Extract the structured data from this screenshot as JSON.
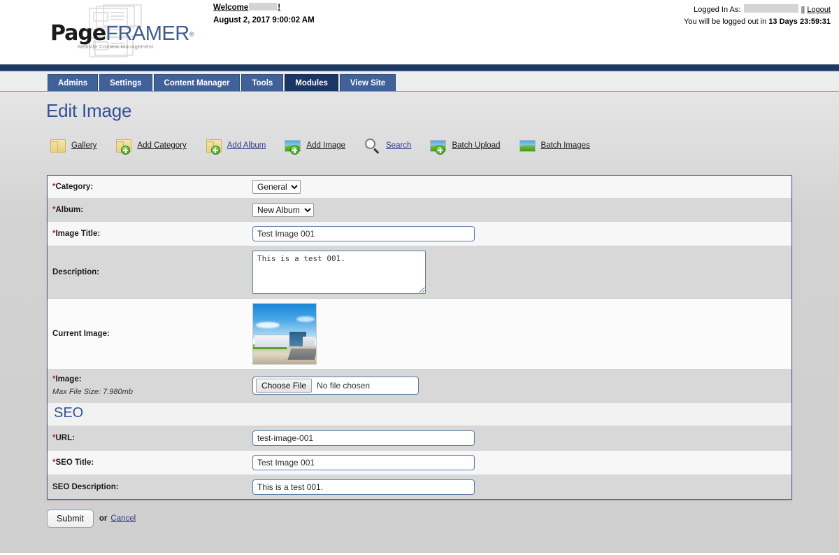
{
  "header": {
    "logo": {
      "part1": "Page",
      "part2": "FRAMER",
      "registered": "®",
      "tagline": "Website Content Management"
    },
    "welcome_label": "Welcome",
    "welcome_suffix": "!",
    "datetime": "August 2, 2017 9:00:02 AM",
    "logged_in_label": "Logged In As:",
    "separator": "||",
    "logout_label": "Logout",
    "logout_notice_prefix": "You will be logged out in",
    "logout_countdown": "13 Days 23:59:31"
  },
  "nav": {
    "tabs": [
      {
        "label": "Admins",
        "active": false
      },
      {
        "label": "Settings",
        "active": false
      },
      {
        "label": "Content Manager",
        "active": false
      },
      {
        "label": "Tools",
        "active": false
      },
      {
        "label": "Modules",
        "active": true
      },
      {
        "label": "View Site",
        "active": false
      }
    ]
  },
  "page": {
    "title": "Edit Image"
  },
  "toolbar": {
    "items": [
      {
        "label": "Gallery",
        "icon": "folder-icon",
        "link_style": "dark"
      },
      {
        "label": "Add Category",
        "icon": "folder-add-icon",
        "link_style": "dark"
      },
      {
        "label": "Add Album",
        "icon": "folder-add-icon",
        "link_style": "blue"
      },
      {
        "label": "Add Image",
        "icon": "image-add-icon",
        "link_style": "dark"
      },
      {
        "label": "Search",
        "icon": "search-icon",
        "link_style": "blue"
      },
      {
        "label": "Batch Upload",
        "icon": "image-add-icon",
        "link_style": "dark"
      },
      {
        "label": "Batch Images",
        "icon": "image-icon",
        "link_style": "dark"
      }
    ]
  },
  "form": {
    "category": {
      "label": "Category:",
      "required": true,
      "value": "General",
      "options": [
        "General"
      ]
    },
    "album": {
      "label": "Album:",
      "required": true,
      "value": "New Album",
      "options": [
        "New Album"
      ]
    },
    "image_title": {
      "label": "Image Title:",
      "required": true,
      "value": "Test Image 001",
      "placeholder": ""
    },
    "description": {
      "label": "Description:",
      "required": false,
      "value": "This is a test 001.",
      "placeholder": ""
    },
    "current_image": {
      "label": "Current Image:",
      "required": false,
      "alt": "Photo of a white commercial building under a blue sky"
    },
    "image_upload": {
      "label": "Image:",
      "required": true,
      "note": "Max File Size: 7.980mb",
      "button_label": "Choose File",
      "file_status": "No file chosen"
    },
    "seo_heading": "SEO",
    "url": {
      "label": "URL:",
      "required": true,
      "value": "test-image-001",
      "placeholder": ""
    },
    "seo_title": {
      "label": "SEO Title:",
      "required": true,
      "value": "Test Image 001",
      "placeholder": ""
    },
    "seo_description": {
      "label": "SEO Description:",
      "required": false,
      "value": "This is a test 001.",
      "placeholder": ""
    }
  },
  "actions": {
    "submit_label": "Submit",
    "or_label": "or",
    "cancel_label": "Cancel"
  },
  "colors": {
    "brand_blue": "#31529a",
    "nav_tab": "#41619b",
    "nav_tab_active": "#1b3665",
    "link_blue": "#333b8e",
    "required_red": "#cc2222",
    "panel_border": "#45618d"
  }
}
